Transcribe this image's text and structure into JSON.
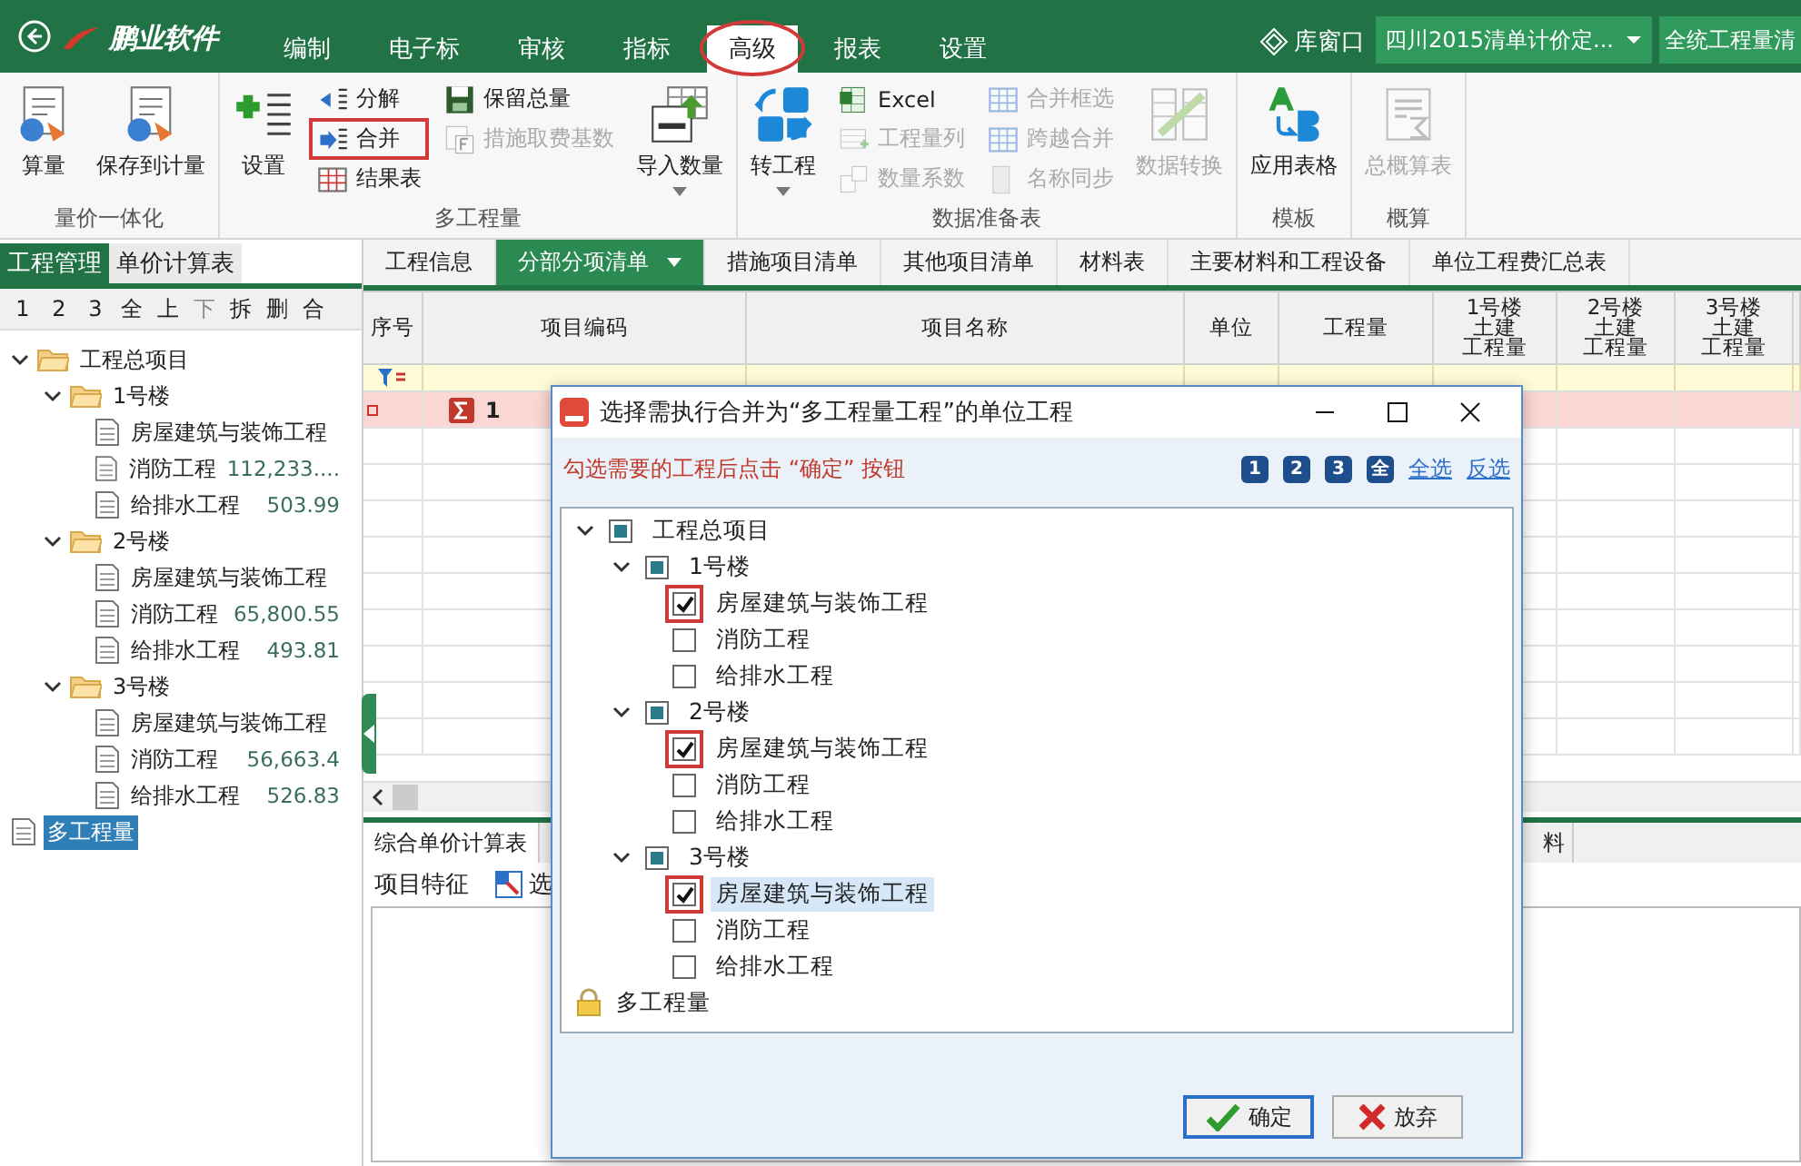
{
  "app": {
    "logo": "鹏业软件",
    "menu": [
      {
        "label": "编制",
        "selected": false,
        "annotated": false
      },
      {
        "label": "电子标",
        "selected": false,
        "annotated": false
      },
      {
        "label": "审核",
        "selected": false,
        "annotated": false
      },
      {
        "label": "指标",
        "selected": false,
        "annotated": false
      },
      {
        "label": "高级",
        "selected": true,
        "annotated": true
      },
      {
        "label": "报表",
        "selected": false,
        "annotated": false
      },
      {
        "label": "设置",
        "selected": false,
        "annotated": false
      }
    ],
    "library": "库窗口",
    "quota_dropdown": "四川2015清单计价定...",
    "rules_dropdown": "全统工程量清"
  },
  "ribbon": {
    "groups": [
      {
        "title": "量价一体化",
        "items": [
          {
            "kind": "large",
            "label": "算量",
            "disabled": false,
            "dropdown": false
          },
          {
            "kind": "large",
            "label": "保存到计量",
            "disabled": false,
            "dropdown": false
          }
        ]
      },
      {
        "title": "多工程量",
        "items": [
          {
            "kind": "large",
            "label": "设置",
            "disabled": false,
            "dropdown": false
          },
          {
            "kind": "column",
            "items": [
              {
                "label": "分解",
                "disabled": false,
                "annotated": false
              },
              {
                "label": "合并",
                "disabled": false,
                "annotated": true
              },
              {
                "label": "结果表",
                "disabled": false,
                "annotated": false
              }
            ]
          },
          {
            "kind": "column",
            "items": [
              {
                "label": "保留总量",
                "disabled": false,
                "annotated": false
              },
              {
                "label": "措施取费基数",
                "disabled": true,
                "annotated": false
              }
            ]
          },
          {
            "kind": "large",
            "label": "导入数量",
            "disabled": false,
            "dropdown": true
          }
        ]
      },
      {
        "title": "数据准备表",
        "items": [
          {
            "kind": "large",
            "label": "转工程",
            "disabled": false,
            "dropdown": true
          },
          {
            "kind": "column",
            "items": [
              {
                "label": "Excel",
                "disabled": false,
                "annotated": false
              },
              {
                "label": "工程量列",
                "disabled": true,
                "annotated": false
              },
              {
                "label": "数量系数",
                "disabled": true,
                "annotated": false
              }
            ]
          },
          {
            "kind": "column",
            "items": [
              {
                "label": "合并框选",
                "disabled": true,
                "annotated": false
              },
              {
                "label": "跨越合并",
                "disabled": true,
                "annotated": false
              },
              {
                "label": "名称同步",
                "disabled": true,
                "annotated": false
              }
            ]
          },
          {
            "kind": "large",
            "label": "数据转换",
            "disabled": true,
            "dropdown": false
          }
        ]
      },
      {
        "title": "模板",
        "items": [
          {
            "kind": "large",
            "label": "应用表格",
            "disabled": false,
            "dropdown": false
          }
        ]
      },
      {
        "title": "概算",
        "items": [
          {
            "kind": "large",
            "label": "总概算表",
            "disabled": true,
            "dropdown": false
          }
        ]
      }
    ]
  },
  "left_panel": {
    "tabs": [
      {
        "label": "工程管理",
        "selected": true
      },
      {
        "label": "单价计算表",
        "selected": false
      }
    ],
    "toolbar": [
      {
        "label": "1",
        "disabled": false
      },
      {
        "label": "2",
        "disabled": false
      },
      {
        "label": "3",
        "disabled": false
      },
      {
        "label": "全",
        "disabled": false
      },
      {
        "label": "上",
        "disabled": false
      },
      {
        "label": "下",
        "disabled": true
      },
      {
        "label": "拆",
        "disabled": false
      },
      {
        "label": "删",
        "disabled": false
      },
      {
        "label": "合",
        "disabled": false
      }
    ],
    "tree": [
      {
        "kind": "folder",
        "label": "工程总项目",
        "expanded": true,
        "children": [
          {
            "kind": "folder",
            "label": "1号楼",
            "expanded": true,
            "children": [
              {
                "kind": "file",
                "label": "房屋建筑与装饰工程",
                "selected": false
              },
              {
                "kind": "file",
                "label": "消防工程",
                "value": "112,233....",
                "selected": false
              },
              {
                "kind": "file",
                "label": "给排水工程",
                "value": "503.99",
                "selected": false
              }
            ]
          },
          {
            "kind": "folder",
            "label": "2号楼",
            "expanded": true,
            "children": [
              {
                "kind": "file",
                "label": "房屋建筑与装饰工程",
                "selected": false
              },
              {
                "kind": "file",
                "label": "消防工程",
                "value": "65,800.55",
                "selected": false
              },
              {
                "kind": "file",
                "label": "给排水工程",
                "value": "493.81",
                "selected": false
              }
            ]
          },
          {
            "kind": "folder",
            "label": "3号楼",
            "expanded": true,
            "children": [
              {
                "kind": "file",
                "label": "房屋建筑与装饰工程",
                "selected": false
              },
              {
                "kind": "file",
                "label": "消防工程",
                "value": "56,663.4",
                "selected": false
              },
              {
                "kind": "file",
                "label": "给排水工程",
                "value": "526.83",
                "selected": false
              }
            ]
          }
        ]
      },
      {
        "kind": "file",
        "label": "多工程量",
        "selected": true
      }
    ]
  },
  "main": {
    "tabs": [
      {
        "label": "工程信息",
        "selected": false
      },
      {
        "label": "分部分项清单",
        "selected": true
      },
      {
        "label": "措施项目清单",
        "selected": false
      },
      {
        "label": "其他项目清单",
        "selected": false
      },
      {
        "label": "材料表",
        "selected": false
      },
      {
        "label": "主要材料和工程设备",
        "selected": false
      },
      {
        "label": "单位工程费汇总表",
        "selected": false
      }
    ],
    "columns": [
      {
        "lines": [
          "序号"
        ]
      },
      {
        "lines": [
          "项目编码"
        ]
      },
      {
        "lines": [
          "项目名称"
        ]
      },
      {
        "lines": [
          "单位"
        ]
      },
      {
        "lines": [
          "工程量"
        ]
      },
      {
        "lines": [
          "1号楼",
          "土建",
          "工程量"
        ]
      },
      {
        "lines": [
          "2号楼",
          "土建",
          "工程量"
        ]
      },
      {
        "lines": [
          "3号楼",
          "土建",
          "工程量"
        ]
      }
    ],
    "rows": [
      {
        "code": "1"
      }
    ],
    "bottom_tabs": [
      {
        "label": "综合单价计算表",
        "selected": true
      },
      {
        "label": "料",
        "selected": false
      }
    ],
    "bottom_toolbar": [
      "项目特征",
      "选"
    ]
  },
  "dialog": {
    "title": "选择需执行合并为“多工程量工程”的单位工程",
    "hint": "勾选需要的工程后点击 “确定” 按钮",
    "levels": [
      "1",
      "2",
      "3",
      "全"
    ],
    "links": [
      "全选",
      "反选"
    ],
    "tree": [
      {
        "kind": "group",
        "label": "工程总项目",
        "partial": true,
        "expanded": true,
        "children": [
          {
            "kind": "group",
            "label": "1号楼",
            "partial": true,
            "expanded": true,
            "children": [
              {
                "kind": "unit",
                "label": "房屋建筑与装饰工程",
                "checked": true,
                "annotated": true,
                "selected": false
              },
              {
                "kind": "unit",
                "label": "消防工程",
                "checked": false,
                "annotated": false,
                "selected": false
              },
              {
                "kind": "unit",
                "label": "给排水工程",
                "checked": false,
                "annotated": false,
                "selected": false
              }
            ]
          },
          {
            "kind": "group",
            "label": "2号楼",
            "partial": true,
            "expanded": true,
            "children": [
              {
                "kind": "unit",
                "label": "房屋建筑与装饰工程",
                "checked": true,
                "annotated": true,
                "selected": false
              },
              {
                "kind": "unit",
                "label": "消防工程",
                "checked": false,
                "annotated": false,
                "selected": false
              },
              {
                "kind": "unit",
                "label": "给排水工程",
                "checked": false,
                "annotated": false,
                "selected": false
              }
            ]
          },
          {
            "kind": "group",
            "label": "3号楼",
            "partial": true,
            "expanded": true,
            "children": [
              {
                "kind": "unit",
                "label": "房屋建筑与装饰工程",
                "checked": true,
                "annotated": true,
                "selected": true
              },
              {
                "kind": "unit",
                "label": "消防工程",
                "checked": false,
                "annotated": false,
                "selected": false
              },
              {
                "kind": "unit",
                "label": "给排水工程",
                "checked": false,
                "annotated": false,
                "selected": false
              }
            ]
          }
        ]
      },
      {
        "kind": "locked",
        "label": "多工程量"
      }
    ],
    "buttons": [
      {
        "label": "确定",
        "kind": "confirm"
      },
      {
        "label": "放弃",
        "kind": "cancel"
      }
    ]
  }
}
